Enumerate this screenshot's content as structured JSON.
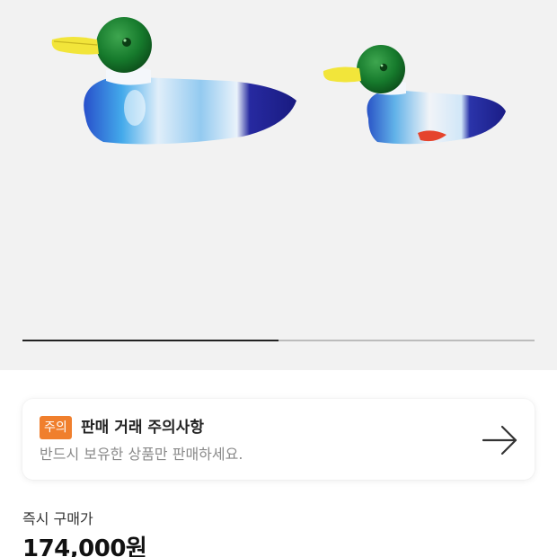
{
  "gallery": {
    "image_name": "glass-duck-figurines",
    "slide_progress": 0.5
  },
  "notice": {
    "badge": "주의",
    "title": "판매 거래 주의사항",
    "description": "반드시 보유한 상품만 판매하세요.",
    "arrow_icon": "arrow-right-icon"
  },
  "price": {
    "label": "즉시 구매가",
    "value": "174,000원"
  },
  "colors": {
    "badge": "#f07f2d",
    "gallery_background": "#f2f2f2",
    "progress_fill": "#222222",
    "progress_track": "#bcbcbc"
  }
}
